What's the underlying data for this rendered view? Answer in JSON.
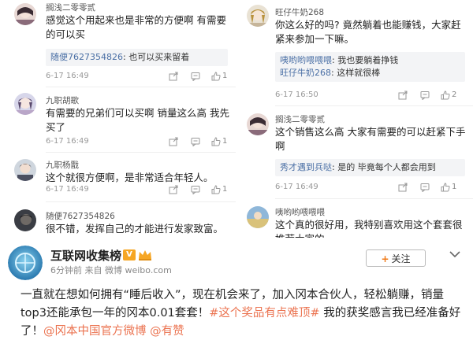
{
  "left_comments": [
    {
      "user": "搁浅二零零贰",
      "text": "感觉这个用起来也是非常的方便啊 有需要的可以买",
      "reply": {
        "name": "随便7627354826",
        "text": ": 也可以买来留着"
      },
      "time": "6-17 16:49",
      "likes": "1"
    },
    {
      "user": "九职胡歌",
      "text": "有需要的兄弟们可以买啊 销量这么高 我先买了",
      "time": "6-17 16:49",
      "likes": "1"
    },
    {
      "user": "九职杨戬",
      "text": "这个就很方便啊，是非常适合年轻人。",
      "time": "6-17 16:49",
      "likes": "1"
    },
    {
      "user": "随便7627354826",
      "text": "很不错，发挥自己的才能进行发家致富。"
    }
  ],
  "right_comments": [
    {
      "user": "旺仔牛奶268",
      "text": "你这么好的吗? 竟然躺着也能赚钱，大家赶紧来参加一下嘛。",
      "replies": [
        {
          "name": "咦哟哟喂喂喂",
          "text": ": 我也要躺着挣钱"
        },
        {
          "name": "旺仔牛奶268",
          "text": ": 这样就很棒"
        }
      ],
      "time": "6-17 16:50",
      "likes": "2"
    },
    {
      "user": "搁浅二零零贰",
      "text": "这个销售这么高 大家有需要的可以赶紧下手啊",
      "reply": {
        "name": "秀才遇到兵哒",
        "text": ": 是的 毕竟每个人都会用到"
      },
      "time": "6-17 16:49",
      "likes": "1"
    },
    {
      "user": "咦哟哟喂喂喂",
      "text": "这个真的很好用，我特别喜欢用这个套套很推荐大家的"
    }
  ],
  "post": {
    "account": "互联网收集榜",
    "verified_badge": "V",
    "time_source": "6分钟前 来自 微博 weibo.com",
    "follow_label": "关注",
    "body_plain_1": "一直就在想如何拥有“睡后收入”，现在机会来了，加入冈本合伙人，轻松躺赚，销量top3还能承包一年的冈本0.01套套！",
    "tag": "#这个奖品有点难顶#",
    "body_plain_2": " 我的获奖感言我已经准备好了！",
    "mention_1": "@冈本中国官方微博",
    "mention_2": " @有赞"
  },
  "colors": {
    "link": "#4a6fa5",
    "accent": "#eb7350",
    "verified": "#f6a623"
  },
  "icons": [
    "share-icon",
    "comment-icon",
    "like-icon",
    "follow-plus-icon",
    "chevron-down-icon"
  ]
}
